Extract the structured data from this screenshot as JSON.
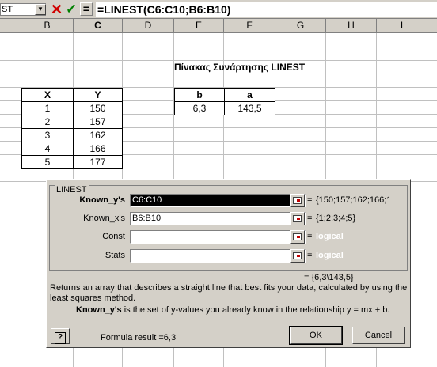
{
  "formula_bar": {
    "name_box": "ST",
    "formula": "=LINEST(C6:C10;B6:B10)",
    "cancel_glyph": "✕",
    "enter_glyph": "✓",
    "equals": "="
  },
  "columns": [
    "B",
    "C",
    "D",
    "E",
    "F",
    "G",
    "H",
    "I"
  ],
  "sheet": {
    "title": "Πίνακας Συνάρτησης LINEST",
    "data_table": {
      "headers": [
        "X",
        "Y"
      ],
      "rows": [
        [
          "1",
          "150"
        ],
        [
          "2",
          "157"
        ],
        [
          "3",
          "162"
        ],
        [
          "4",
          "166"
        ],
        [
          "5",
          "177"
        ]
      ]
    },
    "result_table": {
      "headers": [
        "b",
        "a"
      ],
      "values": [
        "6,3",
        "143,5"
      ]
    }
  },
  "dialog": {
    "group_label": "LINEST",
    "args": [
      {
        "label": "Known_y's",
        "value": "C6:C10",
        "result": "{150;157;162;166;1"
      },
      {
        "label": "Known_x's",
        "value": "B6:B10",
        "result": "{1;2;3;4;5}"
      },
      {
        "label": "Const",
        "value": "",
        "result": "logical"
      },
      {
        "label": "Stats",
        "value": "",
        "result": "logical"
      }
    ],
    "equals": "=",
    "overall_result": "= {6,3\\143,5}",
    "description": "Returns an array that describes a straight line that best fits your data, calculated by using the least squares method.",
    "arg_name": "Known_y's",
    "arg_description": "is the set of y-values you already know in the relationship y = mx + b.",
    "help_glyph": "?",
    "formula_result": "Formula result =6,3",
    "ok_label": "OK",
    "cancel_label": "Cancel"
  }
}
